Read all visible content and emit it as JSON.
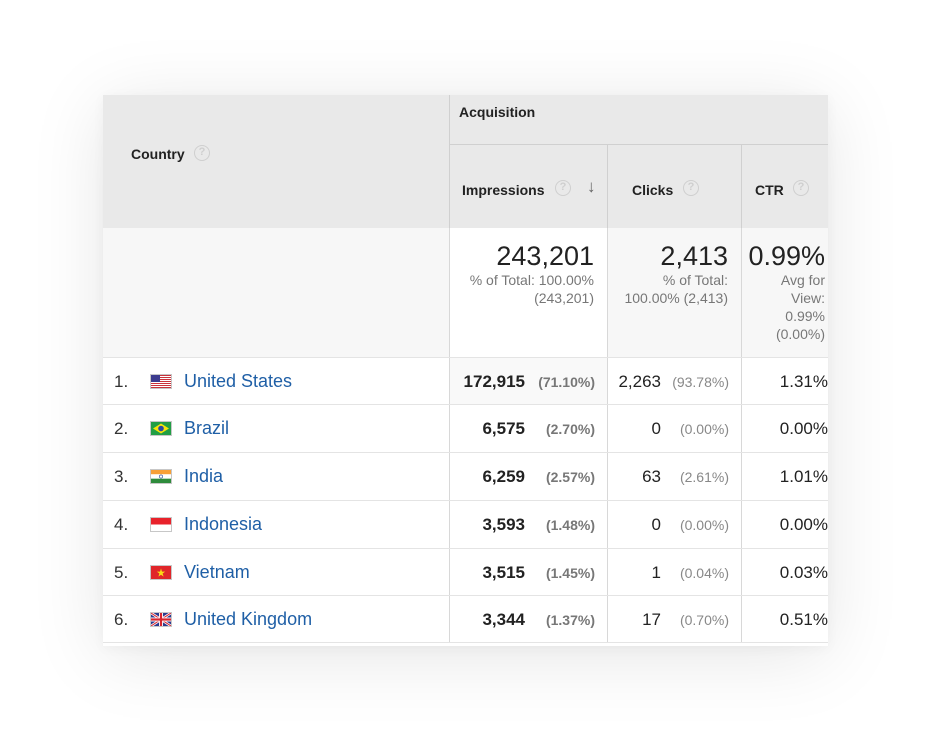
{
  "header": {
    "country_label": "Country",
    "group_label": "Acquisition",
    "impressions_label": "Impressions",
    "clicks_label": "Clicks",
    "ctr_label": "CTR",
    "help_glyph": "?",
    "sort_glyph": "↓"
  },
  "totals": {
    "impressions": "243,201",
    "impressions_sub": "% of Total: 100.00% (243,201)",
    "clicks": "2,413",
    "clicks_sub": "% of Total: 100.00% (2,413)",
    "ctr": "0.99%",
    "ctr_sub": "Avg for View: 0.99% (0.00%)"
  },
  "rows": [
    {
      "rank": "1.",
      "country": "United States",
      "flag": "us-flag-icon",
      "impressions": "172,915",
      "impressions_pct": "(71.10%)",
      "clicks": "2,263",
      "clicks_pct": "(93.78%)",
      "ctr": "1.31%"
    },
    {
      "rank": "2.",
      "country": "Brazil",
      "flag": "brazil-flag-icon",
      "impressions": "6,575",
      "impressions_pct": "(2.70%)",
      "clicks": "0",
      "clicks_pct": "(0.00%)",
      "ctr": "0.00%"
    },
    {
      "rank": "3.",
      "country": "India",
      "flag": "india-flag-icon",
      "impressions": "6,259",
      "impressions_pct": "(2.57%)",
      "clicks": "63",
      "clicks_pct": "(2.61%)",
      "ctr": "1.01%"
    },
    {
      "rank": "4.",
      "country": "Indonesia",
      "flag": "indonesia-flag-icon",
      "impressions": "3,593",
      "impressions_pct": "(1.48%)",
      "clicks": "0",
      "clicks_pct": "(0.00%)",
      "ctr": "0.00%"
    },
    {
      "rank": "5.",
      "country": "Vietnam",
      "flag": "vietnam-flag-icon",
      "impressions": "3,515",
      "impressions_pct": "(1.45%)",
      "clicks": "1",
      "clicks_pct": "(0.04%)",
      "ctr": "0.03%"
    },
    {
      "rank": "6.",
      "country": "United Kingdom",
      "flag": "uk-flag-icon",
      "impressions": "3,344",
      "impressions_pct": "(1.37%)",
      "clicks": "17",
      "clicks_pct": "(0.70%)",
      "ctr": "0.51%"
    }
  ],
  "colors": {
    "link": "#1f5fa6",
    "header_bg": "#e9e9e9",
    "totals_bg": "#f7f7f7"
  }
}
